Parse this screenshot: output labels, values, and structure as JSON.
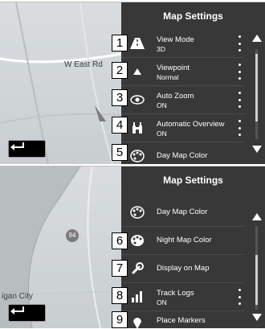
{
  "screen1": {
    "title": "Map Settings",
    "map_labels": [
      "W East Rd"
    ],
    "rows": [
      {
        "callout": "1",
        "icon": "road-3d-icon",
        "label": "View Mode",
        "value": "3D",
        "has_options": true
      },
      {
        "callout": "2",
        "icon": "viewpoint-arrow-icon",
        "label": "Viewpoint",
        "value": "Normal",
        "has_options": true
      },
      {
        "callout": "3",
        "icon": "eye-icon",
        "label": "Auto Zoom",
        "value": "ON",
        "has_options": true
      },
      {
        "callout": "4",
        "icon": "binoculars-icon",
        "label": "Automatic Overview",
        "value": "ON",
        "has_options": true
      },
      {
        "callout": "5",
        "icon": "palette-icon",
        "label": "Day Map Color",
        "value": "",
        "has_options": false
      }
    ]
  },
  "screen2": {
    "title": "Map Settings",
    "map_labels": [
      "94",
      "igan City"
    ],
    "rows": [
      {
        "callout": "",
        "icon": "palette-icon",
        "label": "Day Map Color",
        "value": "",
        "has_options": false
      },
      {
        "callout": "6",
        "icon": "palette-icon",
        "label": "Night Map Color",
        "value": "",
        "has_options": false
      },
      {
        "callout": "7",
        "icon": "wrench-icon",
        "label": "Display on Map",
        "value": "",
        "has_options": false
      },
      {
        "callout": "8",
        "icon": "bar-chart-icon",
        "label": "Track Logs",
        "value": "ON",
        "has_options": true
      },
      {
        "callout": "9",
        "icon": "map-pin-icon",
        "label": "Place Markers",
        "value": "",
        "has_options": false
      }
    ]
  },
  "colors": {
    "panel": "#383838",
    "map": "#d0d4d7",
    "text": "#ffffff"
  }
}
